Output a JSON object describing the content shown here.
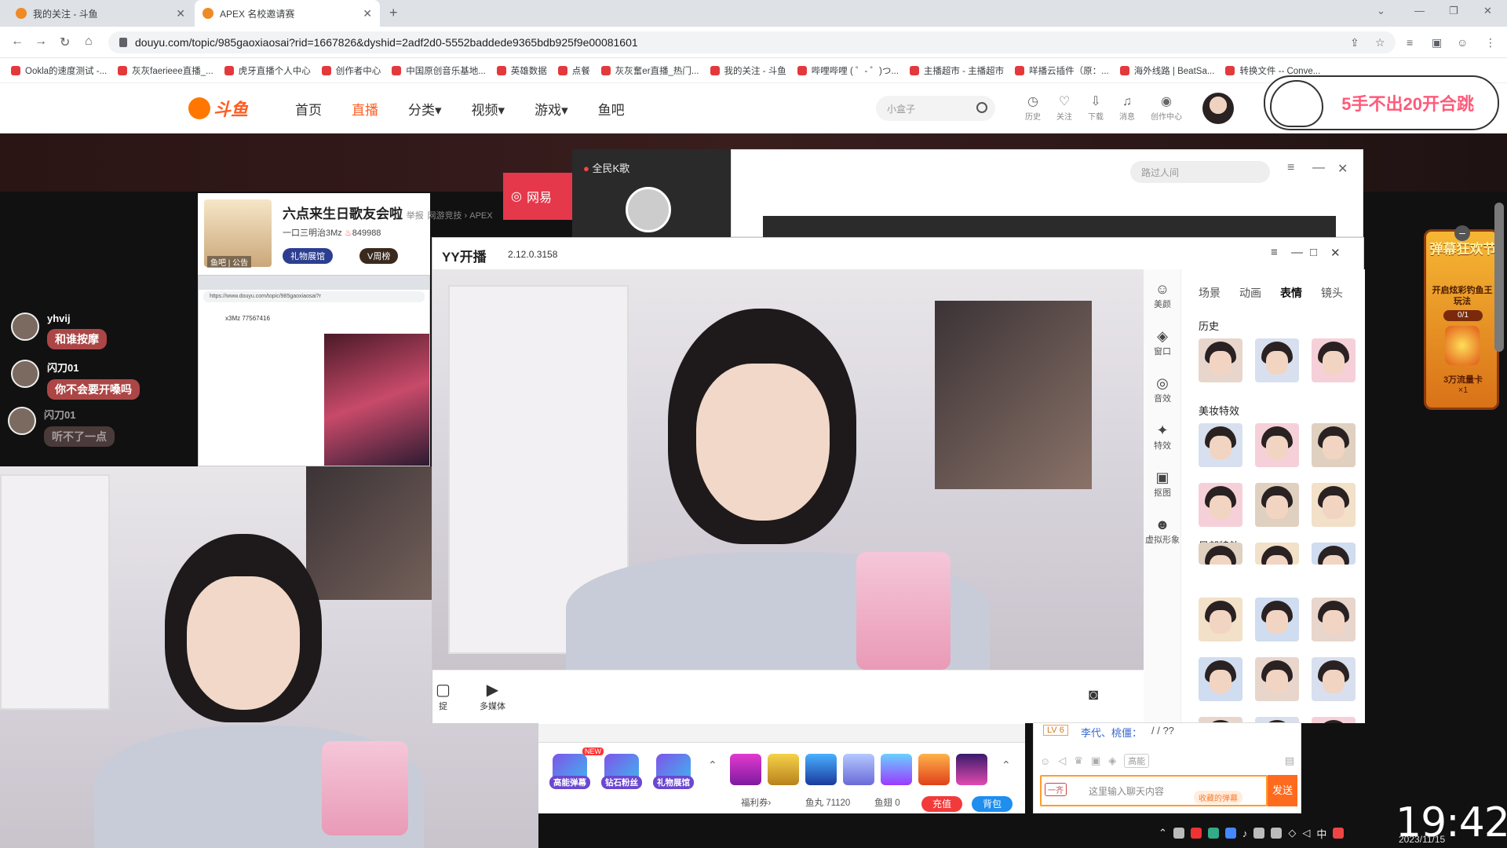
{
  "browser": {
    "tabs": [
      {
        "title": "我的关注 - 斗鱼"
      },
      {
        "title": "APEX 名校邀请赛"
      }
    ],
    "url": "douyu.com/topic/985gaoxiaosai?rid=1667826&dyshid=2adf2d0-5552baddede9365bdb925f9e00081601",
    "bookmarks": [
      "Ookla的速度测试 -...",
      "灰灰faerieee直播_...",
      "虎牙直播个人中心",
      "创作者中心",
      "中国原创音乐基地...",
      "英雄数据",
      "点餐",
      "灰灰奮er直播_热门...",
      "我的关注 - 斗鱼",
      "哔哩哔哩 ( ゜- ゜)つ...",
      "主播超市 - 主播超市",
      "咩播云插件（原：...",
      "海外线路 | BeatSa...",
      "转换文件 -- Conve..."
    ]
  },
  "douyu": {
    "logo": "斗鱼",
    "nav": [
      {
        "label": "首页"
      },
      {
        "label": "直播"
      },
      {
        "label": "分类▾"
      },
      {
        "label": "视频▾"
      },
      {
        "label": "游戏▾"
      },
      {
        "label": "鱼吧"
      }
    ],
    "search_placeholder": "小盒子",
    "icons": [
      {
        "icon": "history-icon",
        "glyph": "◷",
        "label": "历史"
      },
      {
        "icon": "heart-icon",
        "glyph": "♡",
        "label": "关注"
      },
      {
        "icon": "download-icon",
        "glyph": "⇩",
        "label": "下载"
      },
      {
        "icon": "bell-icon",
        "glyph": "♫",
        "label": "消息"
      },
      {
        "icon": "bulb-icon",
        "glyph": "◉",
        "label": "创作中心"
      }
    ],
    "promo": "5手不出20开合跳"
  },
  "chat_overlay": [
    {
      "name": "yhvij",
      "msg": "和谁按摩"
    },
    {
      "name": "闪刀01",
      "msg": "你不会要开嗓吗"
    },
    {
      "name": "闪刀01",
      "msg": "听不了一点"
    }
  ],
  "info_card": {
    "title": "六点来生日歌友会啦",
    "report": "举报",
    "category": "网游竞技 › APEX",
    "sub": "一口三明治3Mz",
    "popularity": "849988",
    "avatar_tags": "鱼吧 | 公告",
    "pill1": "礼物展馆",
    "pill2": "V周榜"
  },
  "mini_browser": {
    "url": "https://www.douyu.com/topic/985gaoxiaosai?r",
    "name": "x3Mz",
    "id": "77567416"
  },
  "netease": "网易",
  "quanmin": "全民K歌",
  "bg_window": {
    "search": "路过人间"
  },
  "yy": {
    "title": "YY开播",
    "version": "2.12.0.3158",
    "side": [
      {
        "icon": "beauty-icon",
        "glyph": "☺",
        "label": "美颜"
      },
      {
        "icon": "layers-icon",
        "glyph": "◈",
        "label": "窗口"
      },
      {
        "icon": "sound-icon",
        "glyph": "◎",
        "label": "音效"
      },
      {
        "icon": "effects-icon",
        "glyph": "✦",
        "label": "特效"
      },
      {
        "icon": "matting-icon",
        "glyph": "▣",
        "label": "抠图"
      },
      {
        "icon": "avatar-icon",
        "glyph": "☻",
        "label": "虚拟形象"
      }
    ],
    "tabs": [
      {
        "label": "场景"
      },
      {
        "label": "动画"
      },
      {
        "label": "表情"
      },
      {
        "label": "镜头"
      }
    ],
    "sections": [
      "历史",
      "美妆特效",
      "局部特效"
    ],
    "bottom": [
      {
        "icon": "capture-icon",
        "glyph": "▢",
        "label": "捉"
      },
      {
        "icon": "media-icon",
        "glyph": "▶",
        "label": "多媒体"
      }
    ]
  },
  "gifts": [
    {
      "label": "高能弹幕"
    },
    {
      "label": "钻石粉丝"
    },
    {
      "label": "礼物展馆"
    }
  ],
  "gift_new": "NEW",
  "wallet": {
    "welfare": "福利券›",
    "fishball": "鱼丸 71120",
    "fishfin": "鱼翅 0",
    "recharge": "充值",
    "bag": "背包"
  },
  "chat_input": {
    "level": "LV 6",
    "nick": "李代、桃僵：",
    "text": "/ / ??",
    "tag": "高能",
    "placeholder": "这里输入聊天内容",
    "fav": "收藏的弹幕",
    "send": "发送",
    "badge": "一齐"
  },
  "event": {
    "title": "弹幕狂欢节",
    "desc": "开启炫彩钓鱼王玩法",
    "progress": "0/1",
    "reward": "3万流量卡",
    "count": "×1"
  },
  "taskbar": {
    "ime": "中",
    "time": "19:42",
    "date": "2023/11/15"
  }
}
